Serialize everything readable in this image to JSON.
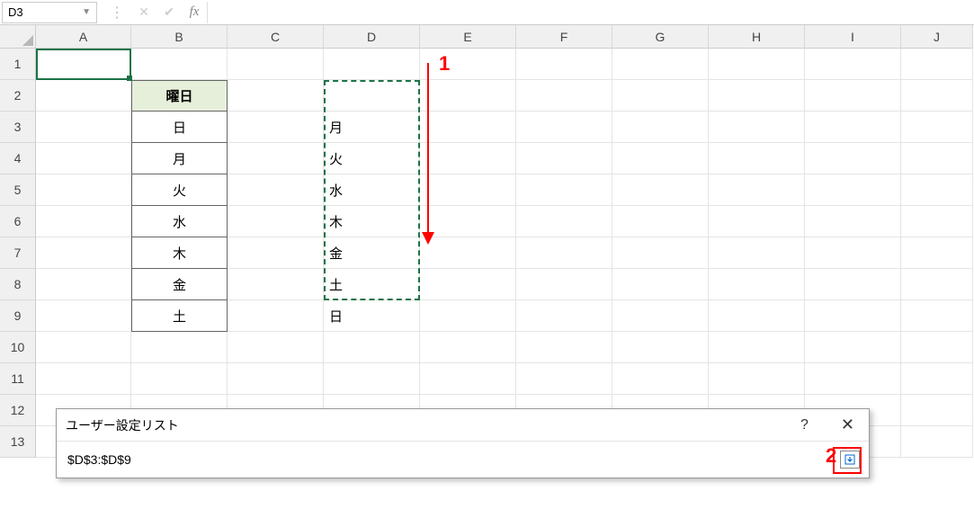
{
  "name_box": "D3",
  "formula_bar": "",
  "columns": [
    "A",
    "B",
    "C",
    "D",
    "E",
    "F",
    "G",
    "H",
    "I",
    "J"
  ],
  "rows": [
    "1",
    "2",
    "3",
    "4",
    "5",
    "6",
    "7",
    "8",
    "9",
    "10",
    "11",
    "12",
    "13"
  ],
  "table_b": {
    "header": "曜日",
    "items": [
      "日",
      "月",
      "火",
      "水",
      "木",
      "金",
      "土"
    ]
  },
  "selection_d": [
    "月",
    "火",
    "水",
    "木",
    "金",
    "土",
    "日"
  ],
  "dialog": {
    "title": "ユーザー設定リスト",
    "value": "$D$3:$D$9"
  },
  "annotations": {
    "one": "1",
    "two": "2"
  },
  "fx_label": "fx"
}
